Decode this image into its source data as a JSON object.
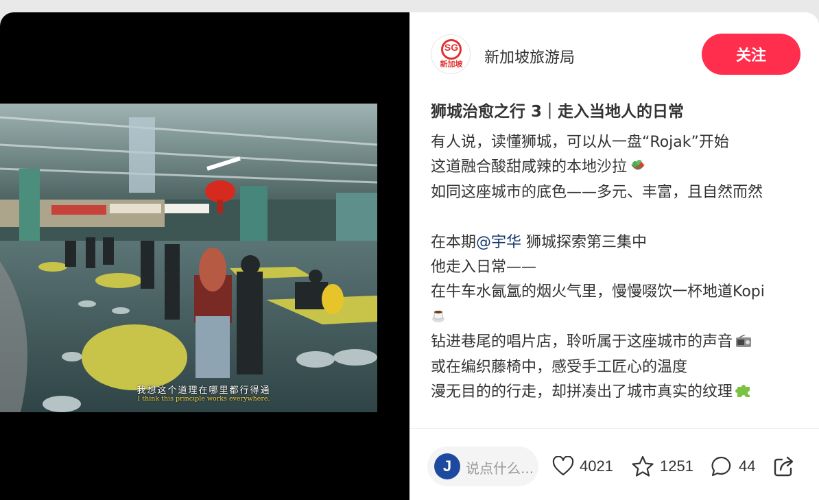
{
  "video": {
    "subtitle_cn": "我想这个道理在哪里都行得通",
    "subtitle_en": "I think this principle works everywhere."
  },
  "author": {
    "avatar_logo_text": "SG",
    "avatar_sub_text": "新加坡",
    "name": "新加坡旅游局",
    "follow_label": "关注"
  },
  "post": {
    "title": "狮城治愈之行 3｜走入当地人的日常",
    "lines": {
      "l1": "有人说，读懂狮城，可以从一盘“Rojak”开始",
      "l2": "这道融合酸甜咸辣的本地沙拉",
      "l3": "如同这座城市的底色——多元、丰富，且自然而然",
      "l5_before": "在本期",
      "l5_mention": "@宇华",
      "l5_after": " 狮城探索第三集中",
      "l6": "他走入日常——",
      "l7": "在牛车水氤氲的烟火气里，慢慢啜饮一杯地道Kopi",
      "l9": "钻进巷尾的唱片店，聆听属于这座城市的声音",
      "l10": "或在编织藤椅中，感受手工匠心的温度",
      "l11": "漫无目的的行走，却拼凑出了城市真实的纹理"
    },
    "emoji_icons": [
      "salad-icon",
      "coffee-icon",
      "radio-icon",
      "puzzle-icon"
    ]
  },
  "footer": {
    "comment_avatar_letter": "J",
    "comment_placeholder": "说点什么...",
    "likes": "4021",
    "collects": "1251",
    "comments": "44"
  },
  "colors": {
    "accent": "#ff2e4d",
    "mention": "#13386c",
    "brand_red": "#e1312e"
  }
}
